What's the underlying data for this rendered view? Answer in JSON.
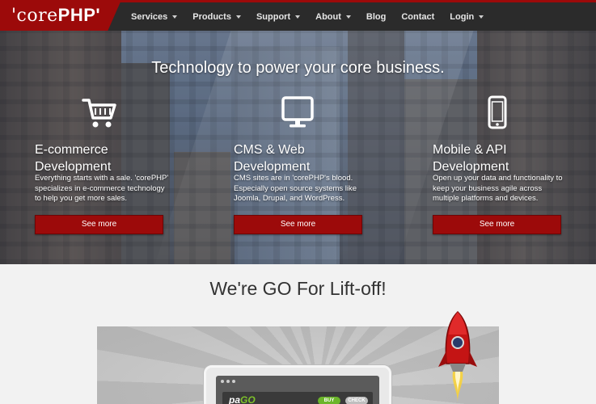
{
  "brand": {
    "prefix": "'core",
    "suffix": "PHP'"
  },
  "nav": [
    {
      "label": "Services",
      "dropdown": true
    },
    {
      "label": "Products",
      "dropdown": true
    },
    {
      "label": "Support",
      "dropdown": true
    },
    {
      "label": "About",
      "dropdown": true
    },
    {
      "label": "Blog",
      "dropdown": false
    },
    {
      "label": "Contact",
      "dropdown": false
    },
    {
      "label": "Login",
      "dropdown": true
    }
  ],
  "hero": {
    "title": "Technology to power your core business.",
    "columns": [
      {
        "icon": "shopping-cart-icon",
        "title_line1": "E-commerce",
        "title_line2": "Development",
        "text": "Everything starts with a sale. 'corePHP' specializes in e-commerce technology to help you get more sales.",
        "button": "See more"
      },
      {
        "icon": "monitor-icon",
        "title_line1": "CMS & Web",
        "title_line2": "Development",
        "text": "CMS sites are in 'corePHP's blood. Especially open source systems like Joomla, Drupal, and WordPress.",
        "button": "See more"
      },
      {
        "icon": "smartphone-icon",
        "title_line1": "Mobile & API",
        "title_line2": "Development",
        "text": "Open up your data and functionality to keep your business agile across multiple platforms and devices.",
        "button": "See more"
      }
    ]
  },
  "section": {
    "title": "We're GO For Lift-off!",
    "promo": {
      "logo_pa": "pa",
      "logo_go": "GO",
      "buy_label": "BUY",
      "check_label": "CHECK"
    }
  },
  "colors": {
    "brand_red": "#9c0a0a",
    "nav_bg": "#2b2b2b",
    "accent_green": "#6bb52a"
  }
}
